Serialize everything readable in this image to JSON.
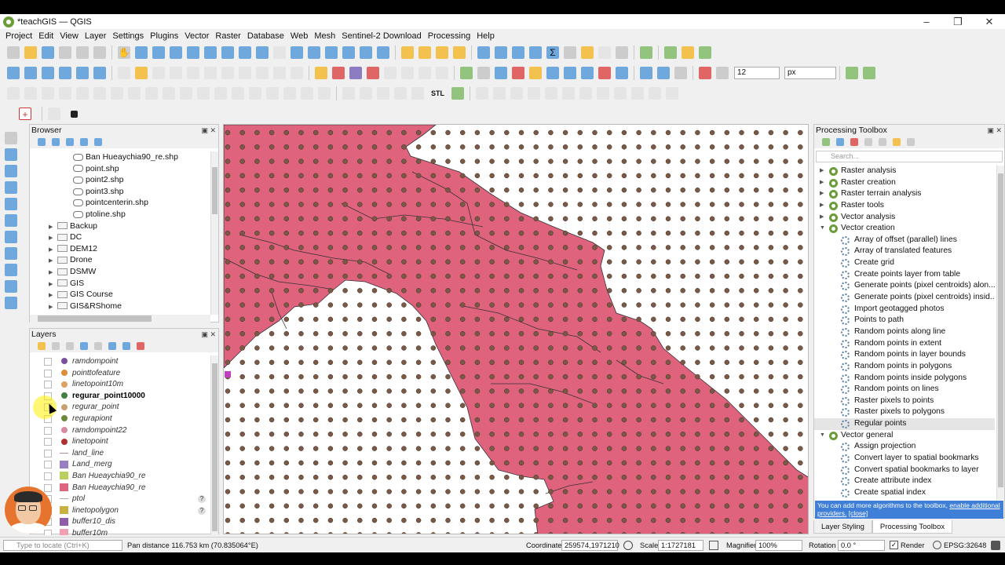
{
  "window": {
    "title": "*teachGIS — QGIS"
  },
  "menu": [
    "Project",
    "Edit",
    "View",
    "Layer",
    "Settings",
    "Plugins",
    "Vector",
    "Raster",
    "Database",
    "Web",
    "Mesh",
    "Sentinel-2 Download",
    "Processing",
    "Help"
  ],
  "toolbar": {
    "snap_tolerance": "12",
    "snap_units": "px",
    "stl_label": "STL"
  },
  "browser": {
    "title": "Browser",
    "items": [
      {
        "label": "Ban Hueaychia90_re.shp",
        "kind": "file",
        "indent": 1
      },
      {
        "label": "point.shp",
        "kind": "file",
        "indent": 1
      },
      {
        "label": "point2.shp",
        "kind": "file",
        "indent": 1
      },
      {
        "label": "point3.shp",
        "kind": "file",
        "indent": 1
      },
      {
        "label": "pointcenterin.shp",
        "kind": "file",
        "indent": 1
      },
      {
        "label": "ptoline.shp",
        "kind": "file",
        "indent": 1
      },
      {
        "label": "Backup",
        "kind": "folder",
        "indent": 0
      },
      {
        "label": "DC",
        "kind": "folder",
        "indent": 0
      },
      {
        "label": "DEM12",
        "kind": "folder",
        "indent": 0
      },
      {
        "label": "Drone",
        "kind": "folder",
        "indent": 0
      },
      {
        "label": "DSMW",
        "kind": "folder",
        "indent": 0
      },
      {
        "label": "GIS",
        "kind": "folder",
        "indent": 0
      },
      {
        "label": "GIS Course",
        "kind": "folder",
        "indent": 0
      },
      {
        "label": "GIS&RShome",
        "kind": "folder",
        "indent": 0
      }
    ]
  },
  "layers": {
    "title": "Layers",
    "items": [
      {
        "label": "ramdompoint",
        "sym": "dot",
        "color": "#7b4fa0"
      },
      {
        "label": "pointtofeature",
        "sym": "dot",
        "color": "#e08a3c"
      },
      {
        "label": "linetopoint10m",
        "sym": "dot",
        "color": "#e0a060"
      },
      {
        "label": "regurar_point10000",
        "sym": "dot",
        "color": "#3f7f3f",
        "selected": true
      },
      {
        "label": "regurar_point",
        "sym": "dot",
        "color": "#c9a070"
      },
      {
        "label": "regurapiont",
        "sym": "dot",
        "color": "#6a8a3a"
      },
      {
        "label": "ramdompoint22",
        "sym": "dot",
        "color": "#d98aa0"
      },
      {
        "label": "linetopoint",
        "sym": "dot",
        "color": "#b03030"
      },
      {
        "label": "land_line",
        "sym": "line",
        "color": "#b89090"
      },
      {
        "label": "Land_merg",
        "sym": "rect",
        "color": "#9a7fc0"
      },
      {
        "label": "Ban Hueaychia90_re",
        "sym": "rect",
        "color": "#b8d060"
      },
      {
        "label": "Ban Hueaychia90_re",
        "sym": "rect",
        "color": "#e0637e"
      },
      {
        "label": "ptol",
        "sym": "line",
        "color": "#aaaaaa",
        "warn": true
      },
      {
        "label": "linetopolygon",
        "sym": "rect",
        "color": "#c9b040",
        "warn": true
      },
      {
        "label": "buffer10_dis",
        "sym": "rect",
        "color": "#8e5ca8"
      },
      {
        "label": "buffer10m",
        "sym": "rect",
        "color": "#f0a0b0"
      }
    ]
  },
  "processing": {
    "title": "Processing Toolbox",
    "search_placeholder": "Search...",
    "groups": [
      {
        "label": "Raster analysis",
        "open": false
      },
      {
        "label": "Raster creation",
        "open": false
      },
      {
        "label": "Raster terrain analysis",
        "open": false
      },
      {
        "label": "Raster tools",
        "open": false
      },
      {
        "label": "Vector analysis",
        "open": false
      },
      {
        "label": "Vector creation",
        "open": true,
        "children": [
          "Array of offset (parallel) lines",
          "Array of translated features",
          "Create grid",
          "Create points layer from table",
          "Generate points (pixel centroids) alon...",
          "Generate points (pixel centroids) insid...",
          "Import geotagged photos",
          "Points to path",
          "Random points along line",
          "Random points in extent",
          "Random points in layer bounds",
          "Random points in polygons",
          "Random points inside polygons",
          "Random points on lines",
          "Raster pixels to points",
          "Raster pixels to polygons",
          "Regular points"
        ]
      },
      {
        "label": "Vector general",
        "open": true,
        "children": [
          "Assign projection",
          "Convert layer to spatial bookmarks",
          "Convert spatial bookmarks to layer",
          "Create attribute index",
          "Create spatial index"
        ]
      }
    ],
    "info_text": "You can add more algorithms to the toolbox,",
    "info_link": "enable additional providers.",
    "info_close": "[close]"
  },
  "tabs": [
    "Layer Styling",
    "Processing Toolbox"
  ],
  "status": {
    "locate_placeholder": "Type to locate (Ctrl+K)",
    "message": "Pan distance 116.753 km (70.835064°E)",
    "coordinate_label": "Coordinate",
    "coordinate": "259574,1971210",
    "scale_label": "Scale",
    "scale": "1:1727181",
    "magnifier_label": "Magnifier",
    "magnifier": "100%",
    "rotation_label": "Rotation",
    "rotation": "0.0 °",
    "render_label": "Render",
    "crs": "EPSG:32648"
  },
  "colors": {
    "polygon": "#e0637e",
    "point": "#7a5a46",
    "accent": "#3f7fd8"
  }
}
